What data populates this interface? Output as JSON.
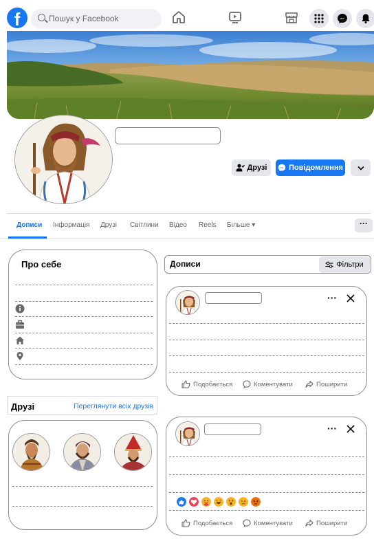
{
  "topbar": {
    "search_placeholder": "Пошук у Facebook",
    "logo_letter": "f",
    "icons": [
      "home-icon",
      "watch-icon",
      "marketplace-icon",
      "menu-grid-icon",
      "messenger-icon",
      "notifications-icon"
    ]
  },
  "profile": {
    "friends_button": "Друзі",
    "message_button": "Повідомлення"
  },
  "tabs": [
    {
      "label": "Дописи",
      "active": true
    },
    {
      "label": "Інформація"
    },
    {
      "label": "Друзі"
    },
    {
      "label": "Світлини"
    },
    {
      "label": "Відео"
    },
    {
      "label": "Reels"
    },
    {
      "label": "Більше ▾"
    }
  ],
  "tabs_more_button": "···",
  "about": {
    "title": "Про себе",
    "icons": [
      "info-icon",
      "work-icon",
      "home-icon",
      "location-icon"
    ]
  },
  "friends": {
    "title": "Друзі",
    "see_all": "Переглянути всіх друзів"
  },
  "posts": {
    "title": "Дописи",
    "filters": "Фільтри",
    "more": "···",
    "actions": {
      "like": "Подобається",
      "comment": "Коментувати",
      "share": "Поширити"
    }
  },
  "colors": {
    "brand": "#1877f2",
    "button_gray": "#e4e6eb",
    "text_secondary": "#65676b"
  }
}
